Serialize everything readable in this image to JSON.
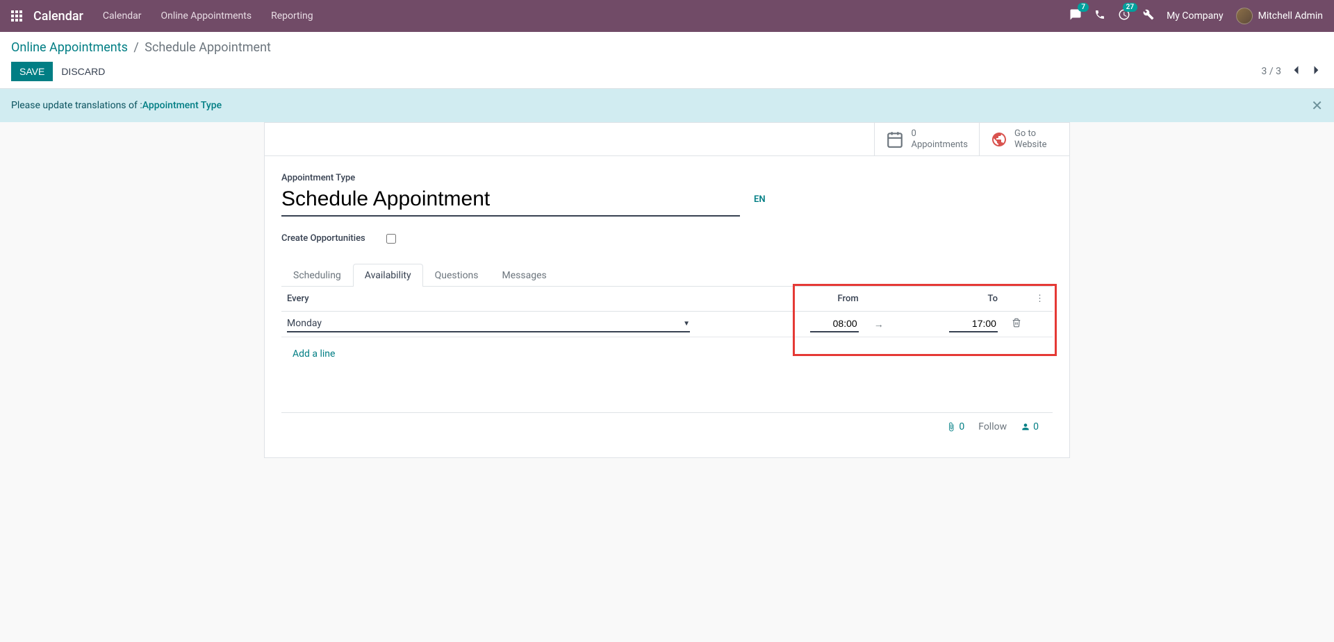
{
  "nav": {
    "brand": "Calendar",
    "links": [
      "Calendar",
      "Online Appointments",
      "Reporting"
    ],
    "messages_badge": "7",
    "activities_badge": "27",
    "company": "My Company",
    "user": "Mitchell Admin"
  },
  "breadcrumb": {
    "parent": "Online Appointments",
    "current": "Schedule Appointment"
  },
  "actions": {
    "save": "SAVE",
    "discard": "DISCARD",
    "pager": "3 / 3"
  },
  "alert": {
    "prefix": "Please update translations of : ",
    "link": "Appointment Type"
  },
  "stat_buttons": {
    "appointments_count": "0",
    "appointments_label": "Appointments",
    "website_line1": "Go to",
    "website_line2": "Website"
  },
  "form": {
    "type_label": "Appointment Type",
    "title": "Schedule Appointment",
    "lang": "EN",
    "create_opp_label": "Create Opportunities",
    "create_opp_checked": false
  },
  "tabs": [
    "Scheduling",
    "Availability",
    "Questions",
    "Messages"
  ],
  "active_tab": "Availability",
  "table": {
    "headers": {
      "every": "Every",
      "from": "From",
      "to": "To"
    },
    "row": {
      "day": "Monday",
      "from": "08:00",
      "to": "17:00"
    },
    "add_line": "Add a line"
  },
  "chatter": {
    "attachments": "0",
    "follow": "Follow",
    "followers": "0"
  }
}
